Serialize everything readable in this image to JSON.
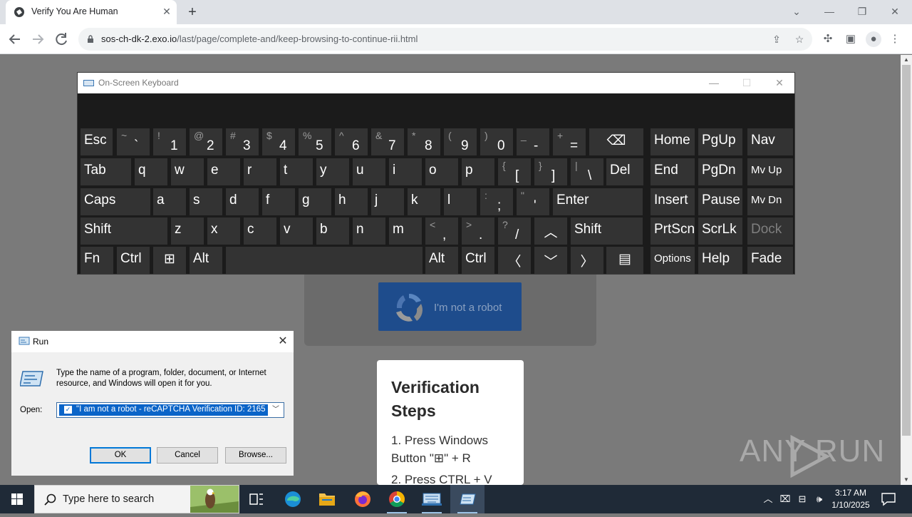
{
  "browser": {
    "tab_title": "Verify You Are Human",
    "tab_close": "✕",
    "new_tab": "+",
    "url_host": "sos-ch-dk-2.exo.io",
    "url_path": "/last/page/complete-and/keep-browsing-to-continue-rii.html",
    "window_controls": {
      "dropdown": "⌄",
      "minimize": "—",
      "restore": "❐",
      "close": "✕"
    }
  },
  "page": {
    "captcha_label": "I'm not a robot",
    "steps_title": "Verification Steps",
    "step_1": "1. Press Windows Button \"⊞\" + R",
    "step_2": "2. Press CTRL + V",
    "watermark": "ANY  RUN"
  },
  "osk": {
    "title": "On-Screen Keyboard",
    "controls": {
      "minimize": "—",
      "maximize": "☐",
      "close": "✕"
    },
    "rows": [
      [
        {
          "label": "Esc"
        },
        {
          "top": "~",
          "bot": "`"
        },
        {
          "top": "!",
          "bot": "1"
        },
        {
          "top": "@",
          "bot": "2"
        },
        {
          "top": "#",
          "bot": "3"
        },
        {
          "top": "$",
          "bot": "4"
        },
        {
          "top": "%",
          "bot": "5"
        },
        {
          "top": "^",
          "bot": "6"
        },
        {
          "top": "&",
          "bot": "7"
        },
        {
          "top": "*",
          "bot": "8"
        },
        {
          "top": "(",
          "bot": "9"
        },
        {
          "top": ")",
          "bot": "0"
        },
        {
          "top": "_",
          "bot": "-"
        },
        {
          "top": "+",
          "bot": "="
        },
        {
          "label": "⌫"
        },
        {
          "label": "Home"
        },
        {
          "label": "PgUp"
        },
        {
          "label": "Nav"
        }
      ],
      [
        {
          "label": "Tab"
        },
        {
          "label": "q"
        },
        {
          "label": "w"
        },
        {
          "label": "e"
        },
        {
          "label": "r"
        },
        {
          "label": "t"
        },
        {
          "label": "y"
        },
        {
          "label": "u"
        },
        {
          "label": "i"
        },
        {
          "label": "o"
        },
        {
          "label": "p"
        },
        {
          "top": "{",
          "bot": "["
        },
        {
          "top": "}",
          "bot": "]"
        },
        {
          "top": "|",
          "bot": "\\"
        },
        {
          "label": "Del"
        },
        {
          "label": "End"
        },
        {
          "label": "PgDn"
        },
        {
          "label": "Mv Up"
        }
      ],
      [
        {
          "label": "Caps"
        },
        {
          "label": "a"
        },
        {
          "label": "s"
        },
        {
          "label": "d"
        },
        {
          "label": "f"
        },
        {
          "label": "g"
        },
        {
          "label": "h"
        },
        {
          "label": "j"
        },
        {
          "label": "k"
        },
        {
          "label": "l"
        },
        {
          "top": ":",
          "bot": ";"
        },
        {
          "top": "\"",
          "bot": "'"
        },
        {
          "label": "Enter"
        },
        {
          "label": "Insert"
        },
        {
          "label": "Pause"
        },
        {
          "label": "Mv Dn"
        }
      ],
      [
        {
          "label": "Shift"
        },
        {
          "label": "z"
        },
        {
          "label": "x"
        },
        {
          "label": "c"
        },
        {
          "label": "v"
        },
        {
          "label": "b"
        },
        {
          "label": "n"
        },
        {
          "label": "m"
        },
        {
          "top": "<",
          "bot": ","
        },
        {
          "top": ">",
          "bot": "."
        },
        {
          "top": "?",
          "bot": "/"
        },
        {
          "label": "︿"
        },
        {
          "label": "Shift"
        },
        {
          "label": "PrtScn"
        },
        {
          "label": "ScrLk"
        },
        {
          "label": "Dock"
        }
      ],
      [
        {
          "label": "Fn"
        },
        {
          "label": "Ctrl"
        },
        {
          "label": "⊞"
        },
        {
          "label": "Alt"
        },
        {
          "label": ""
        },
        {
          "label": "Alt"
        },
        {
          "label": "Ctrl"
        },
        {
          "label": "〈"
        },
        {
          "label": "﹀"
        },
        {
          "label": "〉"
        },
        {
          "label": "▤"
        },
        {
          "label": "Options"
        },
        {
          "label": "Help"
        },
        {
          "label": "Fade"
        }
      ]
    ]
  },
  "run": {
    "title": "Run",
    "close": "✕",
    "description": "Type the name of a program, folder, document, or Internet resource, and Windows will open it for you.",
    "open_label": "Open:",
    "open_value": "\"I am not a robot - reCAPTCHA Verification ID: 2165",
    "ok": "OK",
    "cancel": "Cancel",
    "browse": "Browse..."
  },
  "taskbar": {
    "search_placeholder": "Type here to search",
    "time": "3:17 AM",
    "date": "1/10/2025"
  },
  "colors": {
    "page_bg": "#7a7a7a",
    "captcha_button": "#1e4c8c",
    "osk_bg": "#1b1b1b",
    "osk_key": "#333333",
    "taskbar": "#1f2a37",
    "run_selection": "#0a64c8"
  }
}
